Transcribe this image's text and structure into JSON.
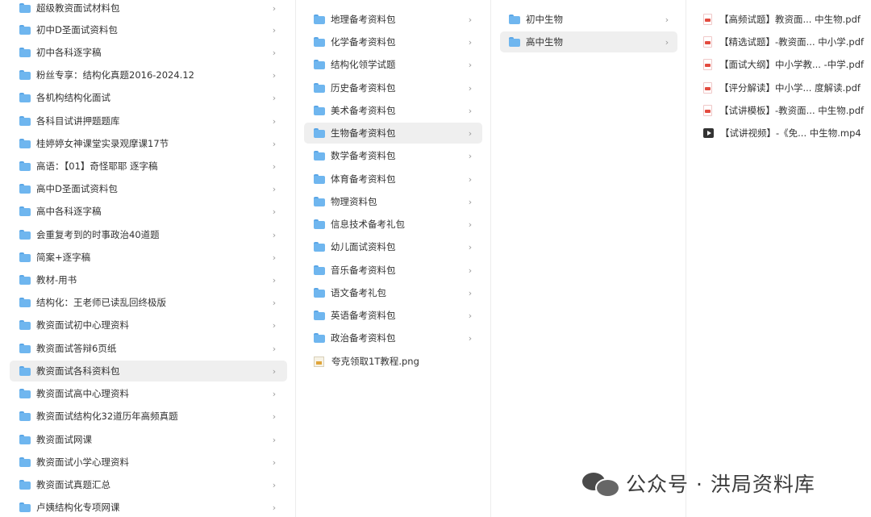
{
  "column1": {
    "items": [
      {
        "label": "超级教资面试材料包"
      },
      {
        "label": "初中D圣面试资料包"
      },
      {
        "label": "初中各科逐字稿"
      },
      {
        "label": "粉丝专享：结构化真题2016-2024.12"
      },
      {
        "label": "各机构结构化面试"
      },
      {
        "label": "各科目试讲押题题库"
      },
      {
        "label": "桂婷婷女神课堂实录观摩课17节"
      },
      {
        "label": "高语：【01】奇怪耶耶 逐字稿"
      },
      {
        "label": "高中D圣面试资料包"
      },
      {
        "label": "高中各科逐字稿"
      },
      {
        "label": "会重复考到的时事政治40道题"
      },
      {
        "label": "简案+逐字稿"
      },
      {
        "label": "教材-用书"
      },
      {
        "label": "结构化：王老师已读乱回终极版"
      },
      {
        "label": "教资面试初中心理资料"
      },
      {
        "label": "教资面试答辩6页纸"
      },
      {
        "label": "教资面试各科资料包"
      },
      {
        "label": "教资面试高中心理资料"
      },
      {
        "label": "教资面试结构化32道历年高频真题"
      },
      {
        "label": "教资面试网课"
      },
      {
        "label": "教资面试小学心理资料"
      },
      {
        "label": "教资面试真题汇总"
      },
      {
        "label": "卢姨结构化专项网课"
      }
    ],
    "selected_index": 16
  },
  "column2": {
    "items": [
      {
        "label": "地理备考资料包"
      },
      {
        "label": "化学备考资料包"
      },
      {
        "label": "结构化领学试题"
      },
      {
        "label": "历史备考资料包"
      },
      {
        "label": "美术备考资料包"
      },
      {
        "label": "生物备考资料包"
      },
      {
        "label": "数学备考资料包"
      },
      {
        "label": "体育备考资料包"
      },
      {
        "label": "物理资料包"
      },
      {
        "label": "信息技术备考礼包"
      },
      {
        "label": "幼儿面试资料包"
      },
      {
        "label": "音乐备考资料包"
      },
      {
        "label": "语文备考礼包"
      },
      {
        "label": "英语备考资料包"
      },
      {
        "label": "政治备考资料包"
      }
    ],
    "file": {
      "label": "夸克领取1T教程.png",
      "icon": "image-file-icon"
    },
    "selected_index": 5
  },
  "column3": {
    "items": [
      {
        "label": "初中生物"
      },
      {
        "label": "高中生物"
      }
    ],
    "selected_index": 1
  },
  "column4": {
    "files": [
      {
        "label": "【高频试题】教资面...  中生物.pdf",
        "icon": "pdf-icon"
      },
      {
        "label": "【精选试题】-教资面...  中小学.pdf",
        "icon": "pdf-icon"
      },
      {
        "label": "【面试大纲】中小学教...  -中学.pdf",
        "icon": "pdf-icon"
      },
      {
        "label": "【评分解读】中小学...  度解读.pdf",
        "icon": "pdf-icon"
      },
      {
        "label": "【试讲模板】-教资面...  中生物.pdf",
        "icon": "pdf-icon"
      },
      {
        "label": "【试讲视频】-《免...  中生物.mp4",
        "icon": "video-icon"
      }
    ]
  },
  "icons": {
    "folder": "folder-icon",
    "chevron": "chevron-right-icon",
    "chevron_glyph": "›"
  },
  "watermark": {
    "text": "公众号 · 洪局资料库",
    "icon": "wechat-icon"
  },
  "colors": {
    "folder": "#6fb6ef",
    "selection": "#efefef",
    "pdf": "#e34b3f",
    "separator": "#ececec"
  }
}
